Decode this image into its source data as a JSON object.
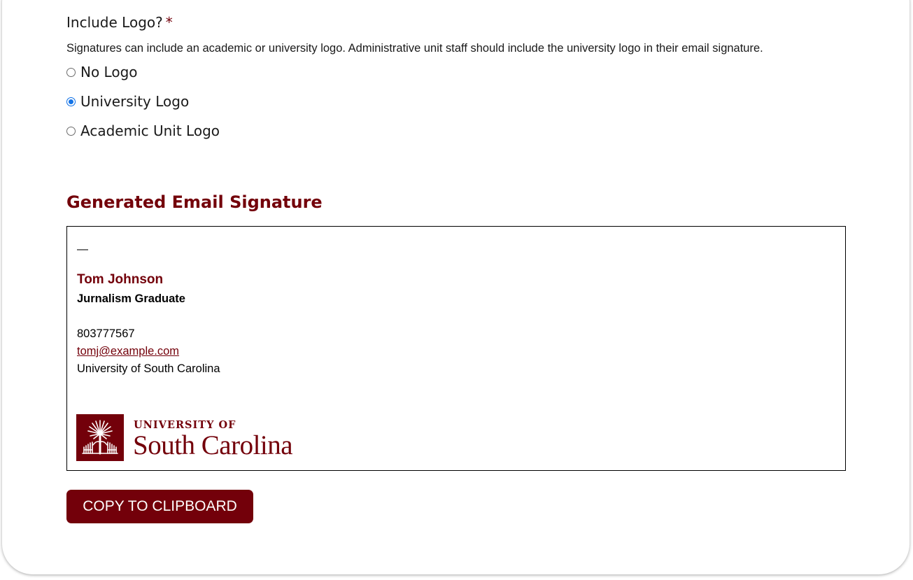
{
  "logo_field": {
    "label": "Include Logo?",
    "required_marker": "*",
    "help_text": "Signatures can include an academic or university logo. Administrative unit staff should include the university logo in their email signature.",
    "options": [
      {
        "label": "No Logo",
        "checked": false
      },
      {
        "label": "University Logo",
        "checked": true
      },
      {
        "label": "Academic Unit Logo",
        "checked": false
      }
    ]
  },
  "signature": {
    "heading": "Generated Email Signature",
    "separator": "—",
    "name": "Tom Johnson",
    "title": "Jurnalism Graduate",
    "phone": "803777567",
    "email": "tomj@example.com",
    "organization": "University of South Carolina",
    "logo": {
      "line1": "UNIVERSITY OF",
      "line2": "South Carolina",
      "icon": "palmetto-tree-icon"
    }
  },
  "actions": {
    "copy_label": "COPY TO CLIPBOARD"
  },
  "colors": {
    "brand_garnet": "#73000a",
    "radio_selected": "#1473e6"
  }
}
